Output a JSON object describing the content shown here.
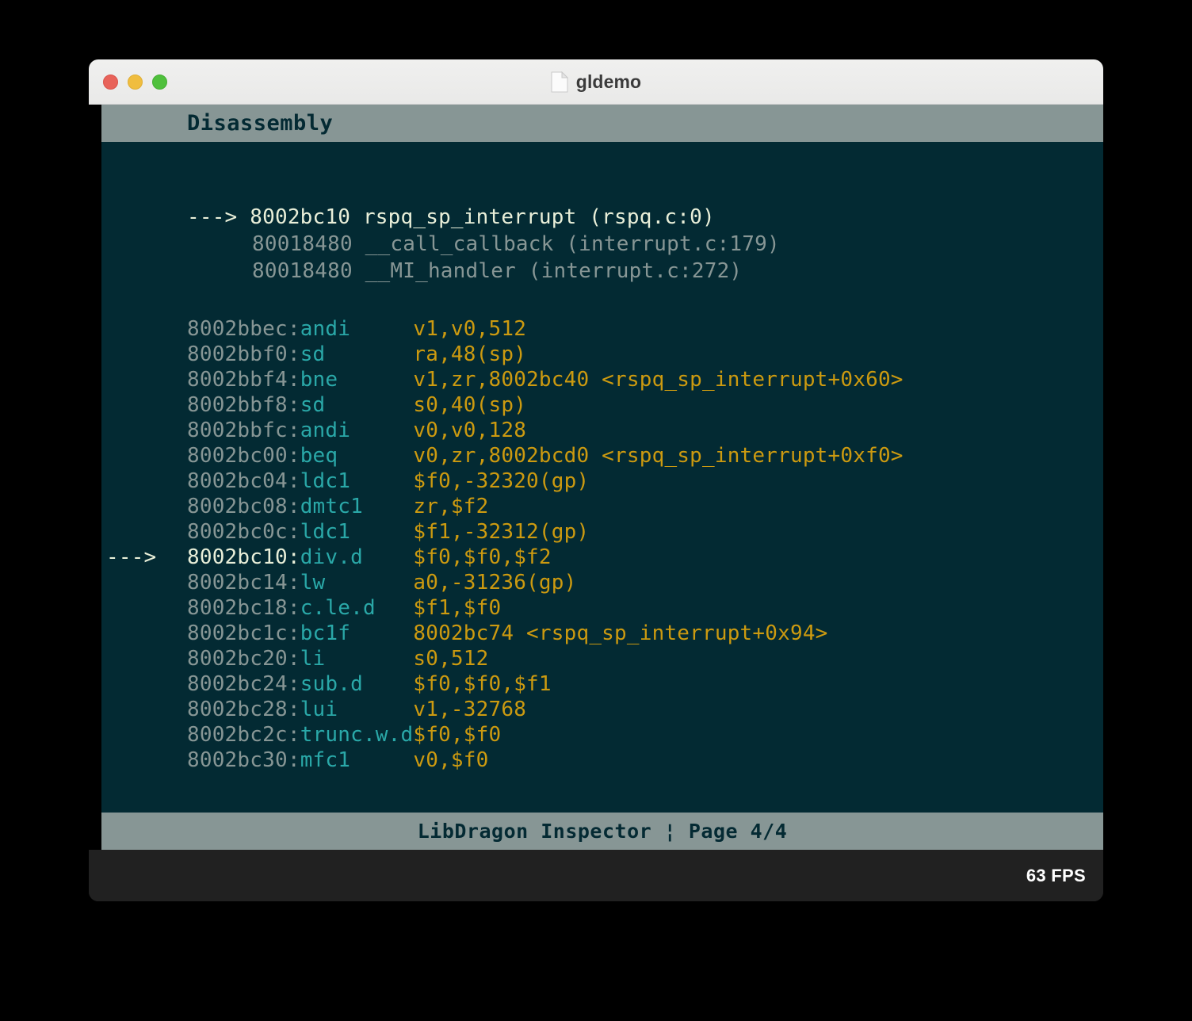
{
  "window": {
    "title": "gldemo",
    "doc_icon": "document-icon",
    "traffic_lights": [
      {
        "name": "close",
        "color": "#e8635a"
      },
      {
        "name": "minimize",
        "color": "#f0bd3e"
      },
      {
        "name": "maximize",
        "color": "#4fc03c"
      }
    ]
  },
  "inspector": {
    "header_title": "Disassembly",
    "footer_text": "LibDragon Inspector ¦ Page 4/4",
    "colors": {
      "panel_bar": "#879695",
      "background": "#032a33",
      "address": "#879695",
      "mnemonic": "#2aa8a8",
      "operands": "#cc9a10",
      "highlight": "#e9efd9",
      "statusbar": "#212121"
    },
    "callstack": [
      {
        "arrow": "---> ",
        "address": "8002bc10",
        "symbol": "rspq_sp_interrupt",
        "location": "(rspq.c:0)",
        "text": "---> 8002bc10 rspq_sp_interrupt (rspq.c:0)",
        "current": true
      },
      {
        "arrow": "",
        "address": "80018480",
        "symbol": "__call_callback",
        "location": "(interrupt.c:179)",
        "text": "80018480 __call_callback (interrupt.c:179)",
        "current": false
      },
      {
        "arrow": "",
        "address": "80018480",
        "symbol": "__MI_handler",
        "location": "(interrupt.c:272)",
        "text": "80018480 __MI_handler (interrupt.c:272)",
        "current": false
      }
    ],
    "instructions": [
      {
        "arrow": "",
        "address": "8002bbec:",
        "mnemonic": "andi     ",
        "operands": "v1,v0,512",
        "current": false
      },
      {
        "arrow": "",
        "address": "8002bbf0:",
        "mnemonic": "sd       ",
        "operands": "ra,48(sp)",
        "current": false
      },
      {
        "arrow": "",
        "address": "8002bbf4:",
        "mnemonic": "bne      ",
        "operands": "v1,zr,8002bc40 <rspq_sp_interrupt+0x60>",
        "current": false
      },
      {
        "arrow": "",
        "address": "8002bbf8:",
        "mnemonic": "sd       ",
        "operands": "s0,40(sp)",
        "current": false
      },
      {
        "arrow": "",
        "address": "8002bbfc:",
        "mnemonic": "andi     ",
        "operands": "v0,v0,128",
        "current": false
      },
      {
        "arrow": "",
        "address": "8002bc00:",
        "mnemonic": "beq      ",
        "operands": "v0,zr,8002bcd0 <rspq_sp_interrupt+0xf0>",
        "current": false
      },
      {
        "arrow": "",
        "address": "8002bc04:",
        "mnemonic": "ldc1     ",
        "operands": "$f0,-32320(gp)",
        "current": false
      },
      {
        "arrow": "",
        "address": "8002bc08:",
        "mnemonic": "dmtc1    ",
        "operands": "zr,$f2",
        "current": false
      },
      {
        "arrow": "",
        "address": "8002bc0c:",
        "mnemonic": "ldc1     ",
        "operands": "$f1,-32312(gp)",
        "current": false
      },
      {
        "arrow": "---> ",
        "address": "8002bc10:",
        "mnemonic": "div.d    ",
        "operands": "$f0,$f0,$f2",
        "current": true
      },
      {
        "arrow": "",
        "address": "8002bc14:",
        "mnemonic": "lw       ",
        "operands": "a0,-31236(gp)",
        "current": false
      },
      {
        "arrow": "",
        "address": "8002bc18:",
        "mnemonic": "c.le.d   ",
        "operands": "$f1,$f0",
        "current": false
      },
      {
        "arrow": "",
        "address": "8002bc1c:",
        "mnemonic": "bc1f     ",
        "operands": "8002bc74 <rspq_sp_interrupt+0x94>",
        "current": false
      },
      {
        "arrow": "",
        "address": "8002bc20:",
        "mnemonic": "li       ",
        "operands": "s0,512",
        "current": false
      },
      {
        "arrow": "",
        "address": "8002bc24:",
        "mnemonic": "sub.d    ",
        "operands": "$f0,$f0,$f1",
        "current": false
      },
      {
        "arrow": "",
        "address": "8002bc28:",
        "mnemonic": "lui      ",
        "operands": "v1,-32768",
        "current": false
      },
      {
        "arrow": "",
        "address": "8002bc2c:",
        "mnemonic": "trunc.w.d",
        "operands": "$f0,$f0",
        "current": false
      },
      {
        "arrow": "",
        "address": "8002bc30:",
        "mnemonic": "mfc1     ",
        "operands": "v0,$f0",
        "current": false
      }
    ]
  },
  "statusbar": {
    "fps": "63 FPS"
  }
}
